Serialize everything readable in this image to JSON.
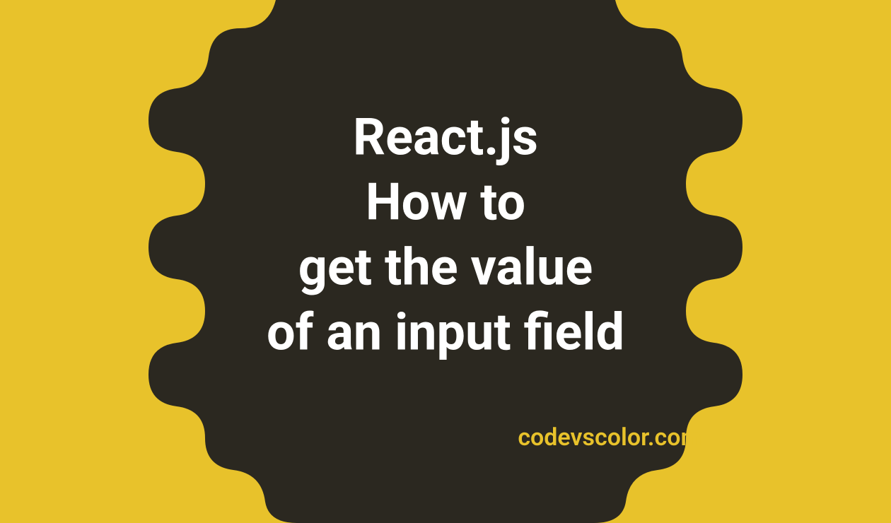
{
  "title": {
    "line1": "React.js",
    "line2": "How to",
    "line3": "get the value",
    "line4": "of an input field"
  },
  "watermark": "codevscolor.com",
  "colors": {
    "background": "#e8c22b",
    "blob": "#2b2820",
    "titleText": "#ffffff"
  }
}
